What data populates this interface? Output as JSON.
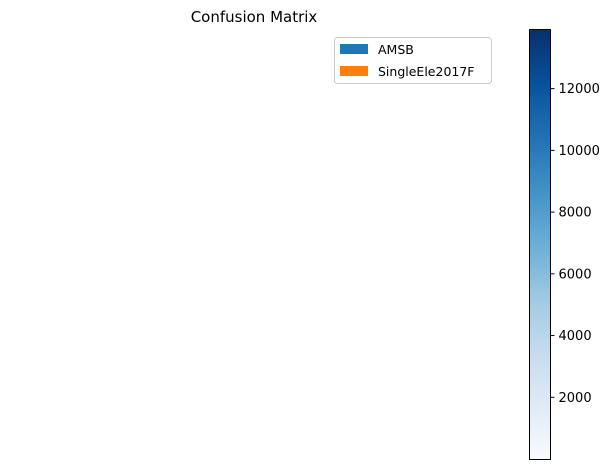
{
  "chart_data": {
    "type": "heatmap",
    "title": "Confusion Matrix",
    "xlabel": "",
    "ylabel": "",
    "legend": {
      "placement": "top-right",
      "entries": [
        {
          "label": "AMSB",
          "color": "#1f77b4"
        },
        {
          "label": "SingleEle2017F",
          "color": "#ff7f0e"
        }
      ]
    },
    "colorbar": {
      "colormap": "Blues",
      "vmin": 0,
      "vmax": 13900,
      "ticks": [
        2000,
        4000,
        6000,
        8000,
        10000,
        12000
      ],
      "tick_labels": [
        "2000",
        "4000",
        "6000",
        "8000",
        "10000",
        "12000"
      ],
      "colors": {
        "low": "#f7fbff",
        "q1": "#deebf7",
        "q2": "#c6dbef",
        "q3": "#9ecae1",
        "q4": "#6baed6",
        "q5": "#4292c6",
        "q6": "#2171b5",
        "q7": "#08519c",
        "high": "#08306b"
      }
    },
    "axes_visible": false,
    "grid": false
  }
}
